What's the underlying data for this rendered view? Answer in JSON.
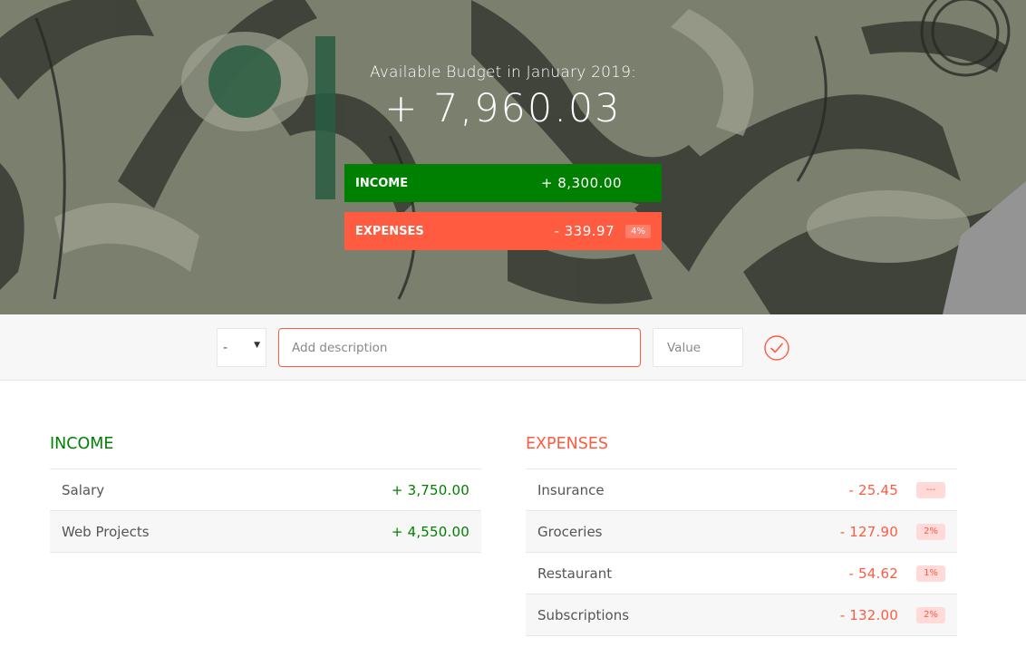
{
  "budget": {
    "title": "Available Budget in January 2019:",
    "value": "+ 7,960.03",
    "income_label": "Income",
    "income_value": "+ 8,300.00",
    "expenses_label": "Expenses",
    "expenses_value": "- 339.97",
    "expenses_percentage": "4%"
  },
  "add": {
    "type_value": "-",
    "description_placeholder": "Add description",
    "value_placeholder": "Value",
    "submit_icon": "checkmark-circle-icon",
    "accent_color": "#ff5b40"
  },
  "income": {
    "title": "Income",
    "color": "#008000",
    "items": [
      {
        "description": "Salary",
        "value": "+ 3,750.00"
      },
      {
        "description": "Web Projects",
        "value": "+ 4,550.00"
      }
    ]
  },
  "expenses": {
    "title": "Expenses",
    "color": "#ff5b40",
    "items": [
      {
        "description": "Insurance",
        "value": "- 25.45",
        "percentage": "---"
      },
      {
        "description": "Groceries",
        "value": "- 127.90",
        "percentage": "2%"
      },
      {
        "description": "Restaurant",
        "value": "- 54.62",
        "percentage": "1%"
      },
      {
        "description": "Subscriptions",
        "value": "- 132.00",
        "percentage": "2%"
      }
    ]
  }
}
